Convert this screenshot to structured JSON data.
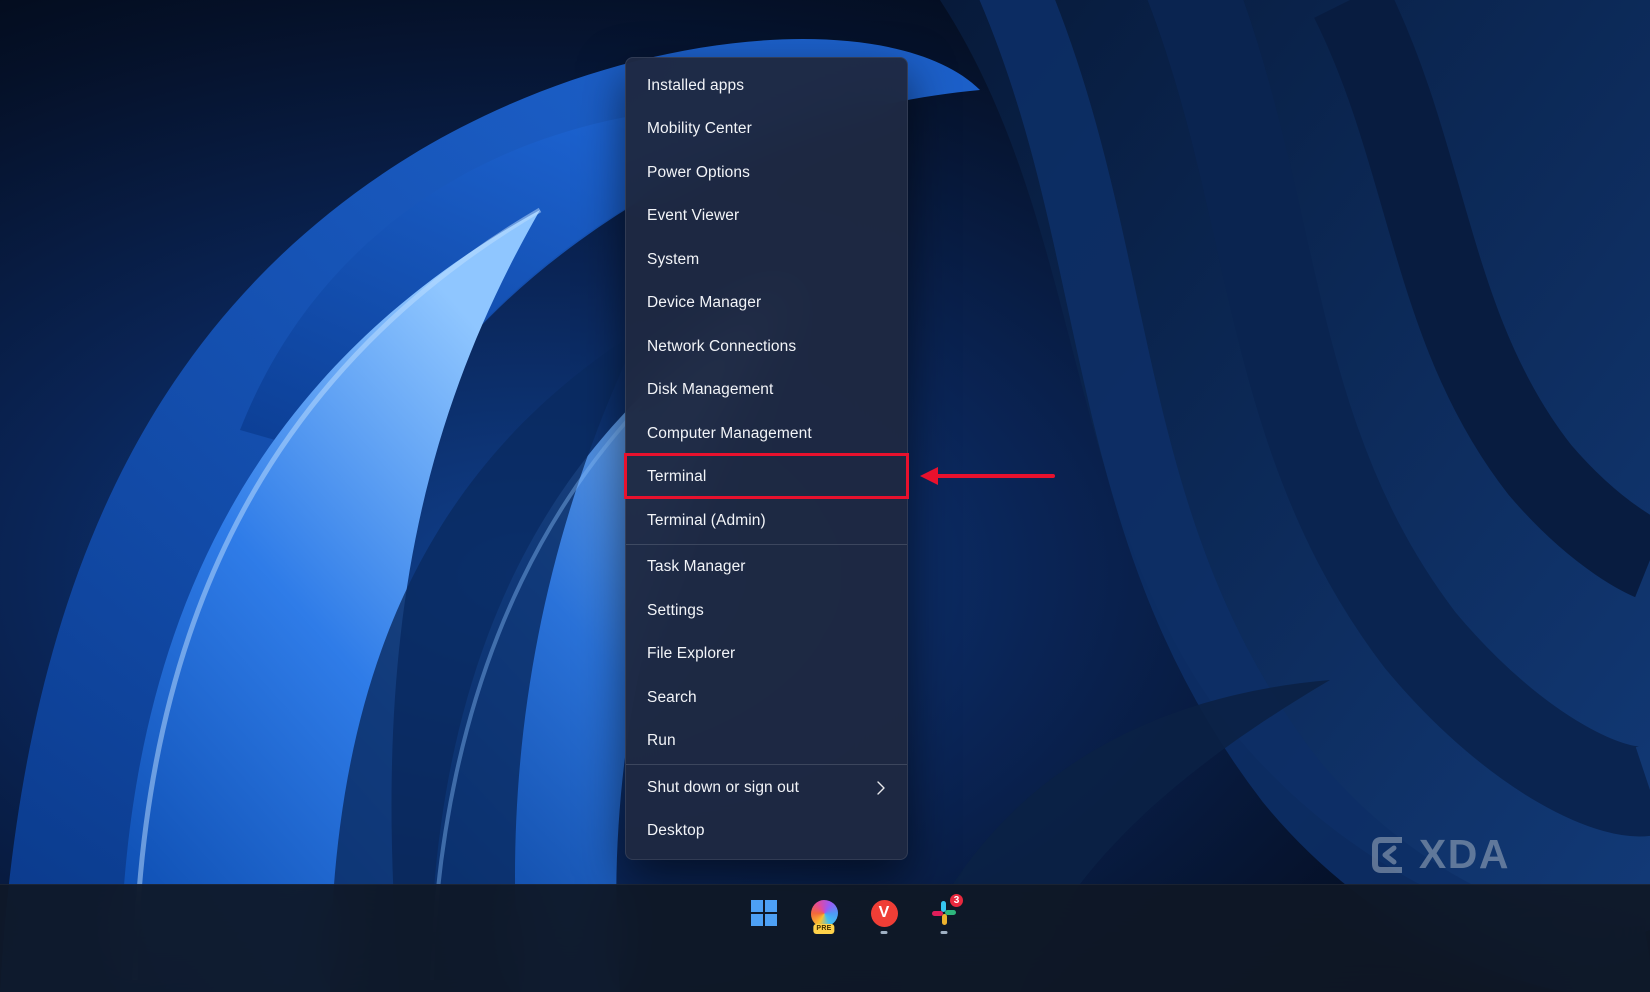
{
  "context_menu": {
    "items": [
      {
        "label": "Installed apps",
        "group": 1
      },
      {
        "label": "Mobility Center",
        "group": 1
      },
      {
        "label": "Power Options",
        "group": 1
      },
      {
        "label": "Event Viewer",
        "group": 1
      },
      {
        "label": "System",
        "group": 1
      },
      {
        "label": "Device Manager",
        "group": 1
      },
      {
        "label": "Network Connections",
        "group": 1
      },
      {
        "label": "Disk Management",
        "group": 1
      },
      {
        "label": "Computer Management",
        "group": 1
      },
      {
        "label": "Terminal",
        "group": 1,
        "highlighted": true
      },
      {
        "label": "Terminal (Admin)",
        "group": 1
      },
      {
        "label": "Task Manager",
        "group": 2
      },
      {
        "label": "Settings",
        "group": 2
      },
      {
        "label": "File Explorer",
        "group": 2
      },
      {
        "label": "Search",
        "group": 2
      },
      {
        "label": "Run",
        "group": 2
      },
      {
        "label": "Shut down or sign out",
        "group": 3,
        "has_submenu": true
      },
      {
        "label": "Desktop",
        "group": 3
      }
    ]
  },
  "annotation": {
    "highlighted_item": "Terminal",
    "color": "#e8112d"
  },
  "taskbar": {
    "copilot_badge": "PRE",
    "slack_badge": "3",
    "vivaldi_glyph": "V"
  },
  "watermark": {
    "text": "XDA"
  },
  "colors": {
    "menu_background": "#1e2942",
    "taskbar_background": "#0f1826",
    "accent_red": "#e8112d",
    "wallpaper_blue": "#2f7ce8"
  }
}
